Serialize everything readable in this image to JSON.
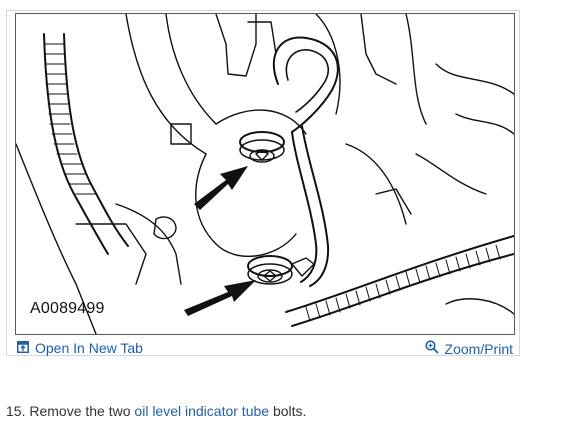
{
  "figure": {
    "id_label": "A0089499"
  },
  "actions": {
    "open_new_tab": "Open In New Tab",
    "zoom_print": "Zoom/Print"
  },
  "icons": {
    "open_tab": "open-in-new-tab-icon",
    "zoom": "magnifier-icon"
  },
  "colors": {
    "link": "#1f5fa8",
    "card_border": "#cfd8e3",
    "body_text": "#333333"
  },
  "instruction": {
    "number": "15.",
    "prefix": "Remove the two",
    "link_text": "oil level indicator tube",
    "suffix": "bolts."
  }
}
